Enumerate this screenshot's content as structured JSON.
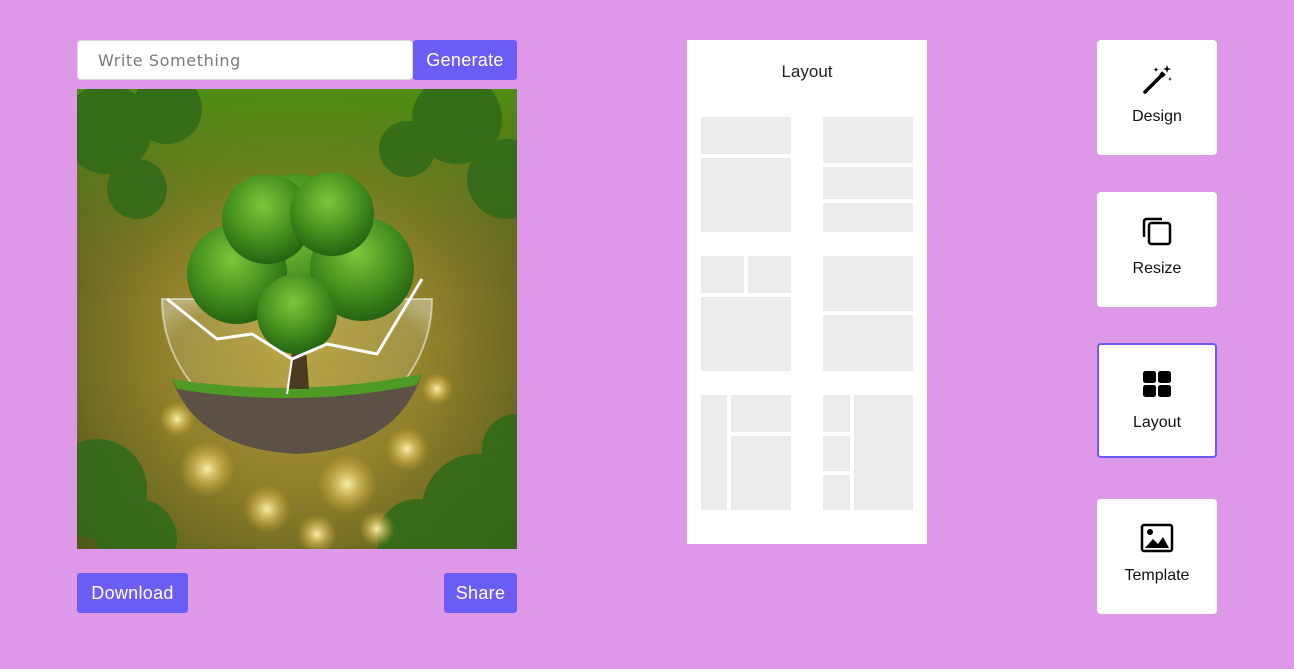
{
  "editor": {
    "prompt_placeholder": "Write Something",
    "prompt_value": "",
    "generate_label": "Generate",
    "download_label": "Download",
    "share_label": "Share",
    "image_subject": "tree-in-glass-globe-image"
  },
  "layout_panel": {
    "title": "Layout",
    "templates_count_label": ""
  },
  "tools": [
    {
      "label": "Design",
      "icon": "magic-wand-icon",
      "active": false
    },
    {
      "label": "Resize",
      "icon": "copy-icon",
      "active": false
    },
    {
      "label": "Layout",
      "icon": "grid-icon",
      "active": true
    },
    {
      "label": "Template",
      "icon": "image-icon",
      "active": false
    }
  ],
  "colors": {
    "background": "#dd99e7",
    "accent": "#6a5cf5",
    "placeholder_block": "#ebebeb"
  }
}
